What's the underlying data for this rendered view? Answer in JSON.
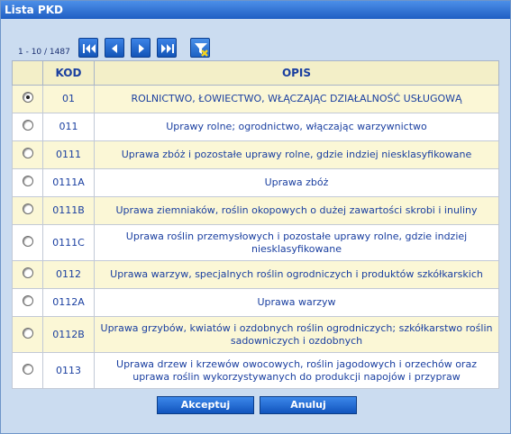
{
  "window": {
    "title": "Lista PKD"
  },
  "pager": {
    "range_text": "1 - 10 / 1487",
    "first_icon": "first-page-icon",
    "prev_icon": "previous-page-icon",
    "next_icon": "next-page-icon",
    "last_icon": "last-page-icon",
    "filter_icon": "clear-filter-icon"
  },
  "table": {
    "headers": {
      "select": "",
      "kod": "KOD",
      "opis": "OPIS"
    },
    "rows": [
      {
        "kod": "01",
        "opis": "ROLNICTWO, ŁOWIECTWO, WŁĄCZAJĄC DZIAŁALNOŚĆ USŁUGOWĄ",
        "selected": true
      },
      {
        "kod": "011",
        "opis": "Uprawy rolne; ogrodnictwo, włączając warzywnictwo",
        "selected": false
      },
      {
        "kod": "0111",
        "opis": "Uprawa zbóż i pozostałe uprawy rolne, gdzie indziej niesklasyfikowane",
        "selected": false
      },
      {
        "kod": "0111A",
        "opis": "Uprawa zbóż",
        "selected": false
      },
      {
        "kod": "0111B",
        "opis": "Uprawa ziemniaków, roślin okopowych o dużej zawartości skrobi i inuliny",
        "selected": false
      },
      {
        "kod": "0111C",
        "opis": "Uprawa roślin przemysłowych i pozostałe uprawy rolne, gdzie indziej niesklasyfikowane",
        "selected": false
      },
      {
        "kod": "0112",
        "opis": "Uprawa warzyw, specjalnych roślin ogrodniczych i produktów szkółkarskich",
        "selected": false
      },
      {
        "kod": "0112A",
        "opis": "Uprawa warzyw",
        "selected": false
      },
      {
        "kod": "0112B",
        "opis": "Uprawa grzybów, kwiatów i ozdobnych roślin ogrodniczych; szkółkarstwo roślin sadowniczych i ozdobnych",
        "selected": false
      },
      {
        "kod": "0113",
        "opis": "Uprawa drzew i krzewów owocowych, roślin jagodowych i orzechów oraz uprawa roślin wykorzystywanych do produkcji napojów i przypraw",
        "selected": false
      }
    ]
  },
  "footer": {
    "accept_label": "Akceptuj",
    "cancel_label": "Anuluj"
  },
  "colors": {
    "header_bg": "#f3efc8",
    "odd_row_bg": "#fbf7d6",
    "button_blue": "#1d62c4",
    "title_blue": "#2d6fd2"
  }
}
